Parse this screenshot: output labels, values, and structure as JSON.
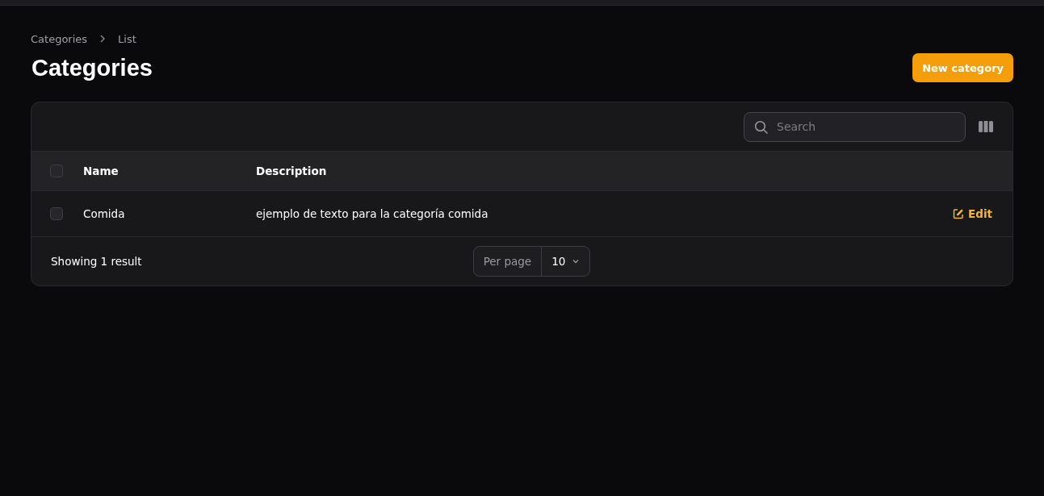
{
  "breadcrumbs": [
    "Categories",
    "List"
  ],
  "title": "Categories",
  "new_button": "New category",
  "search": {
    "placeholder": "Search"
  },
  "table": {
    "select_all": {
      "checked": false
    },
    "columns": [
      "Name",
      "Description"
    ],
    "rows": [
      {
        "checked": false,
        "name": "Comida",
        "description": "ejemplo de texto para la categoría comida",
        "action": "Edit"
      }
    ]
  },
  "footer": {
    "summary": "Showing 1 result",
    "per_page_label": "Per page",
    "per_page_value": "10"
  }
}
